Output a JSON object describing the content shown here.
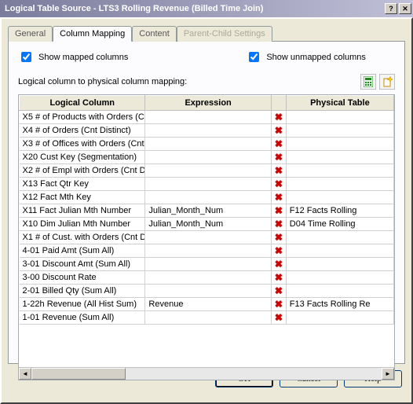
{
  "window": {
    "title": "Logical Table Source - LTS3 Rolling Revenue (Billed Time Join)"
  },
  "tabs": {
    "general": "General",
    "column_mapping": "Column Mapping",
    "content": "Content",
    "parent_child": "Parent-Child Settings"
  },
  "checkboxes": {
    "show_mapped": "Show mapped columns",
    "show_unmapped": "Show unmapped columns"
  },
  "label_mapping": "Logical column to physical column mapping:",
  "grid": {
    "headers": {
      "logical": "Logical Column",
      "expression": "Expression",
      "physical": "Physical Table"
    },
    "rows": [
      {
        "logical": "X5  # of Products with Orders  (C",
        "expression": "",
        "physical": ""
      },
      {
        "logical": "X4  # of Orders  (Cnt Distinct)",
        "expression": "",
        "physical": ""
      },
      {
        "logical": "X3  # of Offices with Orders  (Cnt",
        "expression": "",
        "physical": ""
      },
      {
        "logical": "X20  Cust Key (Segmentation)",
        "expression": "",
        "physical": ""
      },
      {
        "logical": "X2  # of Empl with Orders  (Cnt Di",
        "expression": "",
        "physical": ""
      },
      {
        "logical": "X13  Fact Qtr Key",
        "expression": "",
        "physical": ""
      },
      {
        "logical": "X12  Fact Mth Key",
        "expression": "",
        "physical": ""
      },
      {
        "logical": "X11  Fact Julian Mth Number",
        "expression": "Julian_Month_Num",
        "physical": "F12 Facts Rolling"
      },
      {
        "logical": "X10  Dim Julian Mth Number",
        "expression": "Julian_Month_Num",
        "physical": "D04 Time Rolling"
      },
      {
        "logical": "X1  # of Cust. with Orders  (Cnt Di",
        "expression": "",
        "physical": ""
      },
      {
        "logical": "4-01  Paid Amt  (Sum All)",
        "expression": "",
        "physical": ""
      },
      {
        "logical": "3-01  Discount Amt  (Sum All)",
        "expression": "",
        "physical": ""
      },
      {
        "logical": "3-00  Discount Rate",
        "expression": "",
        "physical": ""
      },
      {
        "logical": "2-01  Billed Qty  (Sum All)",
        "expression": "",
        "physical": ""
      },
      {
        "logical": "1-22h  Revenue  (All Hist Sum)",
        "expression": "Revenue",
        "physical": "F13 Facts Rolling Re"
      },
      {
        "logical": "1-01  Revenue  (Sum All)",
        "expression": "",
        "physical": ""
      }
    ]
  },
  "buttons": {
    "ok": "OK",
    "cancel": "Cancel",
    "help": "Help"
  }
}
